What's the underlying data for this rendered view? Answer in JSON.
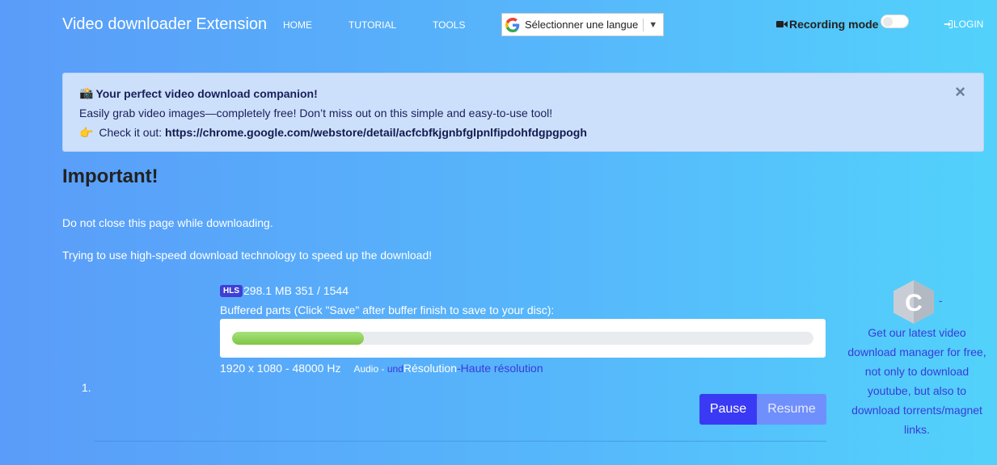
{
  "nav": {
    "brand": "Video downloader Extension",
    "links": [
      "HOME",
      "TUTORIAL",
      "TOOLS"
    ],
    "language_select": "Sélectionner une langue",
    "language_arrow": "▼",
    "recording_label": "Recording mode",
    "login": "LOGIN"
  },
  "alert": {
    "title": "Your perfect video download companion!",
    "line2": "Easily grab video images—completely free! Don’t miss out on this simple and easy-to-use tool!",
    "line3_prefix": "Check it out: ",
    "link": "https://chrome.google.com/webstore/detail/acfcbfkjgnbfglpnlfipdohfdgpgpogh",
    "close": "×",
    "emoji_title": "📸",
    "emoji_pointer": "👉"
  },
  "content": {
    "heading": "Important!",
    "p1": "Do not close this page while downloading.",
    "p2": "Trying to use high-speed download technology to speed up the download!"
  },
  "download": {
    "list_number": "1.",
    "badge": "HLS",
    "stats": "298.1 MB 351 / 1544",
    "buffered_label": "Buffered parts (Click \"Save\" after buffer finish to save to your disc):",
    "progress_percent": 22.7,
    "resolution_info": "1920 x 1080 - 48000 Hz",
    "audio_label": "Audio - ",
    "audio_link": "und",
    "resolution_label": " Résolution",
    "resolution_sep": " - ",
    "resolution_link": "Haute résolution",
    "pause": "Pause",
    "resume": "Resume"
  },
  "promo": {
    "dash": "-",
    "text": "Get our latest video download manager for free, not only to download youtube, but also to download torrents/magnet links."
  },
  "colors": {
    "accent_button": "#3a3af5",
    "link": "#3a3ad9",
    "progress": "#8fd35c"
  }
}
